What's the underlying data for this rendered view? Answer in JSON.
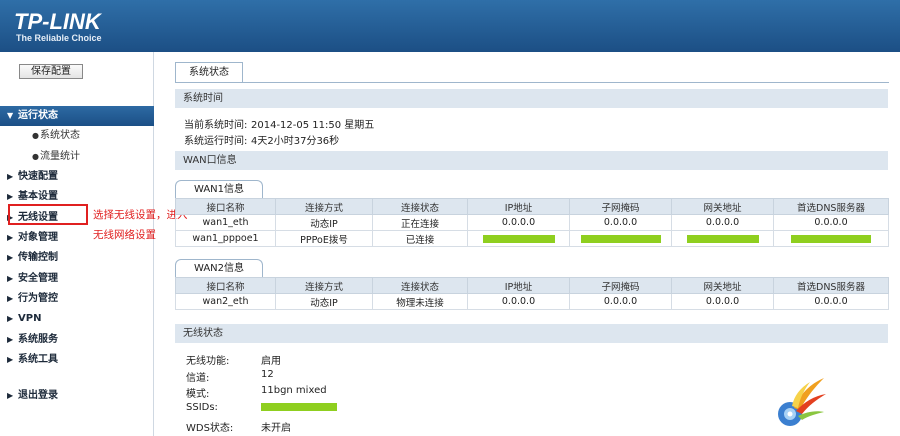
{
  "header": {
    "logo": "TP-LINK",
    "slogan": "The Reliable Choice"
  },
  "sidebar": {
    "save_label": "保存配置",
    "items": [
      {
        "label": "运行状态"
      },
      {
        "label": "系统状态"
      },
      {
        "label": "流量统计"
      },
      {
        "label": "快速配置"
      },
      {
        "label": "基本设置"
      },
      {
        "label": "无线设置"
      },
      {
        "label": "对象管理"
      },
      {
        "label": "传输控制"
      },
      {
        "label": "安全管理"
      },
      {
        "label": "行为管控"
      },
      {
        "label": "VPN"
      },
      {
        "label": "系统服务"
      },
      {
        "label": "系统工具"
      },
      {
        "label": "退出登录"
      }
    ]
  },
  "annotation": {
    "line1": "选择无线设置，进入",
    "line2": "无线网络设置"
  },
  "main": {
    "tab": "系统状态",
    "system_time": {
      "title": "系统时间",
      "current_label": "当前系统时间:",
      "current_value": "2014-12-05 11:50 星期五",
      "uptime_label": "系统运行时间:",
      "uptime_value": "4天2小时37分36秒"
    },
    "wan": {
      "title": "WAN口信息",
      "headers": [
        "接口名称",
        "连接方式",
        "连接状态",
        "IP地址",
        "子网掩码",
        "网关地址",
        "首选DNS服务器"
      ],
      "wan1": {
        "tab": "WAN1信息",
        "rows": [
          [
            "wan1_eth",
            "动态IP",
            "正在连接",
            "0.0.0.0",
            "0.0.0.0",
            "0.0.0.0",
            "0.0.0.0"
          ],
          [
            "wan1_pppoe1",
            "PPPoE拨号",
            "已连接",
            "",
            "",
            "",
            ""
          ]
        ]
      },
      "wan2": {
        "tab": "WAN2信息",
        "rows": [
          [
            "wan2_eth",
            "动态IP",
            "物理未连接",
            "0.0.0.0",
            "0.0.0.0",
            "0.0.0.0",
            "0.0.0.0"
          ]
        ]
      }
    },
    "wireless": {
      "title": "无线状态",
      "func_label": "无线功能:",
      "func_value": "启用",
      "channel_label": "信道:",
      "channel_value": "12",
      "mode_label": "模式:",
      "mode_value": "11bgn mixed",
      "ssid_label": "SSIDs:",
      "wds_label": "WDS状态:",
      "wds_value": "未开启"
    }
  },
  "colors": {
    "header": "#1c4f85",
    "annotation": "#e02020",
    "redacted": "#8fcf1f"
  }
}
